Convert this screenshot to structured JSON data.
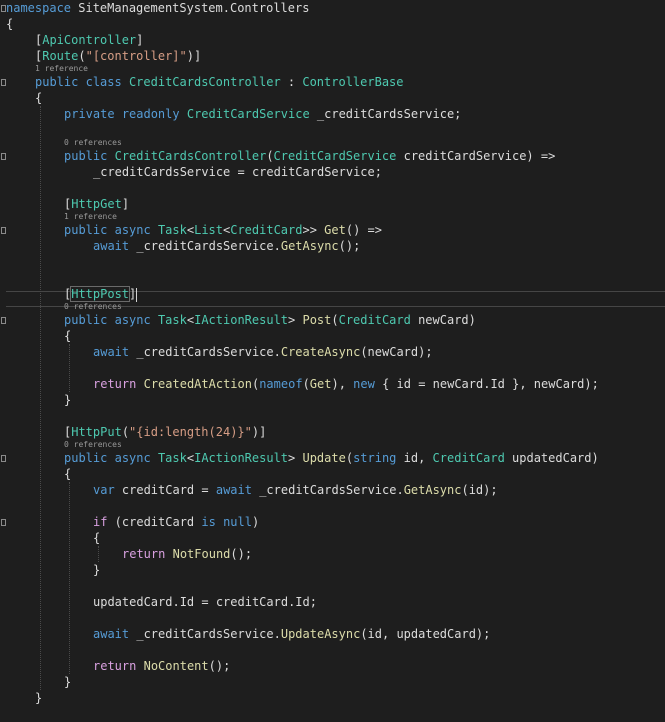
{
  "editor": {
    "colors": {
      "background": "#1e1e1e",
      "keyword": "#569cd6",
      "type": "#4ec9b0",
      "method": "#dcdcaa",
      "string": "#d69d85",
      "control": "#d8a0df",
      "plain": "#dcdcdc",
      "codelens": "#999999"
    },
    "lines": [
      {
        "kind": "code",
        "indent": 0,
        "fold": "open",
        "tokens": [
          [
            "namespace",
            "kw"
          ],
          [
            " SiteManagementSystem.Controllers",
            "p"
          ]
        ]
      },
      {
        "kind": "code",
        "indent": 0,
        "tokens": [
          [
            "{",
            "p"
          ]
        ]
      },
      {
        "kind": "code",
        "indent": 1,
        "tokens": [
          [
            "[",
            "p"
          ],
          [
            "ApiController",
            "ty"
          ],
          [
            "]",
            "p"
          ]
        ]
      },
      {
        "kind": "code",
        "indent": 1,
        "tokens": [
          [
            "[",
            "p"
          ],
          [
            "Route",
            "ty"
          ],
          [
            "(",
            "p"
          ],
          [
            "\"[controller]\"",
            "str"
          ],
          [
            ")]",
            "p"
          ]
        ]
      },
      {
        "kind": "lens",
        "indent": 1,
        "text": "1 reference"
      },
      {
        "kind": "code",
        "indent": 1,
        "fold": "open",
        "tokens": [
          [
            "public",
            "kw"
          ],
          [
            " ",
            "p"
          ],
          [
            "class",
            "kw"
          ],
          [
            " ",
            "p"
          ],
          [
            "CreditCardsController",
            "ty"
          ],
          [
            " : ",
            "p"
          ],
          [
            "ControllerBase",
            "ty"
          ]
        ]
      },
      {
        "kind": "code",
        "indent": 1,
        "tokens": [
          [
            "{",
            "p"
          ]
        ]
      },
      {
        "kind": "code",
        "indent": 2,
        "tokens": [
          [
            "private",
            "kw"
          ],
          [
            " ",
            "p"
          ],
          [
            "readonly",
            "kw"
          ],
          [
            " ",
            "p"
          ],
          [
            "CreditCardService",
            "ty"
          ],
          [
            " _creditCardsService;",
            "p"
          ]
        ]
      },
      {
        "kind": "blank"
      },
      {
        "kind": "lens",
        "indent": 2,
        "text": "0 references"
      },
      {
        "kind": "code",
        "indent": 2,
        "fold": "open",
        "tokens": [
          [
            "public",
            "kw"
          ],
          [
            " ",
            "p"
          ],
          [
            "CreditCardsController",
            "ty"
          ],
          [
            "(",
            "p"
          ],
          [
            "CreditCardService",
            "ty"
          ],
          [
            " creditCardService",
            "p"
          ],
          [
            ") =>",
            "p"
          ]
        ]
      },
      {
        "kind": "code",
        "indent": 3,
        "tokens": [
          [
            "_creditCardsService = creditCardService;",
            "p"
          ]
        ]
      },
      {
        "kind": "blank"
      },
      {
        "kind": "code",
        "indent": 2,
        "tokens": [
          [
            "[",
            "p"
          ],
          [
            "HttpGet",
            "ty"
          ],
          [
            "]",
            "p"
          ]
        ]
      },
      {
        "kind": "lens",
        "indent": 2,
        "text": "1 reference"
      },
      {
        "kind": "code",
        "indent": 2,
        "fold": "open",
        "tokens": [
          [
            "public",
            "kw"
          ],
          [
            " ",
            "p"
          ],
          [
            "async",
            "kw"
          ],
          [
            " ",
            "p"
          ],
          [
            "Task",
            "ty"
          ],
          [
            "<",
            "p"
          ],
          [
            "List",
            "ty"
          ],
          [
            "<",
            "p"
          ],
          [
            "CreditCard",
            "ty"
          ],
          [
            ">> ",
            "p"
          ],
          [
            "Get",
            "m"
          ],
          [
            "() =>",
            "p"
          ]
        ]
      },
      {
        "kind": "code",
        "indent": 3,
        "tokens": [
          [
            "await",
            "kw"
          ],
          [
            " _creditCardsService.",
            "p"
          ],
          [
            "GetAsync",
            "m"
          ],
          [
            "();",
            "p"
          ]
        ]
      },
      {
        "kind": "blank"
      },
      {
        "kind": "blank"
      },
      {
        "kind": "code",
        "indent": 2,
        "current": true,
        "tokens": [
          [
            "[",
            "p"
          ],
          [
            "HttpPost",
            "ty"
          ],
          [
            "]",
            "p"
          ]
        ]
      },
      {
        "kind": "lens",
        "indent": 2,
        "text": "0 references"
      },
      {
        "kind": "code",
        "indent": 2,
        "fold": "open",
        "tokens": [
          [
            "public",
            "kw"
          ],
          [
            " ",
            "p"
          ],
          [
            "async",
            "kw"
          ],
          [
            " ",
            "p"
          ],
          [
            "Task",
            "ty"
          ],
          [
            "<",
            "p"
          ],
          [
            "IActionResult",
            "ty"
          ],
          [
            "> ",
            "p"
          ],
          [
            "Post",
            "m"
          ],
          [
            "(",
            "p"
          ],
          [
            "CreditCard",
            "ty"
          ],
          [
            " newCard)",
            "p"
          ]
        ]
      },
      {
        "kind": "code",
        "indent": 2,
        "tokens": [
          [
            "{",
            "p"
          ]
        ]
      },
      {
        "kind": "code",
        "indent": 3,
        "tokens": [
          [
            "await",
            "kw"
          ],
          [
            " _creditCardsService.",
            "p"
          ],
          [
            "CreateAsync",
            "m"
          ],
          [
            "(newCard);",
            "p"
          ]
        ]
      },
      {
        "kind": "blank"
      },
      {
        "kind": "code",
        "indent": 3,
        "tokens": [
          [
            "return",
            "ctl"
          ],
          [
            " ",
            "p"
          ],
          [
            "CreatedAtAction",
            "m"
          ],
          [
            "(",
            "p"
          ],
          [
            "nameof",
            "kw"
          ],
          [
            "(",
            "p"
          ],
          [
            "Get",
            "m"
          ],
          [
            "), ",
            "p"
          ],
          [
            "new",
            "kw"
          ],
          [
            " { id = newCard.Id }, newCard);",
            "p"
          ]
        ]
      },
      {
        "kind": "code",
        "indent": 2,
        "tokens": [
          [
            "}",
            "p"
          ]
        ]
      },
      {
        "kind": "blank"
      },
      {
        "kind": "code",
        "indent": 2,
        "tokens": [
          [
            "[",
            "p"
          ],
          [
            "HttpPut",
            "ty"
          ],
          [
            "(",
            "p"
          ],
          [
            "\"{id:length(24)}\"",
            "str"
          ],
          [
            ")]",
            "p"
          ]
        ]
      },
      {
        "kind": "lens",
        "indent": 2,
        "text": "0 references"
      },
      {
        "kind": "code",
        "indent": 2,
        "fold": "open",
        "tokens": [
          [
            "public",
            "kw"
          ],
          [
            " ",
            "p"
          ],
          [
            "async",
            "kw"
          ],
          [
            " ",
            "p"
          ],
          [
            "Task",
            "ty"
          ],
          [
            "<",
            "p"
          ],
          [
            "IActionResult",
            "ty"
          ],
          [
            "> ",
            "p"
          ],
          [
            "Update",
            "m"
          ],
          [
            "(",
            "p"
          ],
          [
            "string",
            "kw"
          ],
          [
            " id, ",
            "p"
          ],
          [
            "CreditCard",
            "ty"
          ],
          [
            " updatedCard)",
            "p"
          ]
        ]
      },
      {
        "kind": "code",
        "indent": 2,
        "tokens": [
          [
            "{",
            "p"
          ]
        ]
      },
      {
        "kind": "code",
        "indent": 3,
        "tokens": [
          [
            "var",
            "kw"
          ],
          [
            " creditCard = ",
            "p"
          ],
          [
            "await",
            "kw"
          ],
          [
            " _creditCardsService.",
            "p"
          ],
          [
            "GetAsync",
            "m"
          ],
          [
            "(id);",
            "p"
          ]
        ]
      },
      {
        "kind": "blank"
      },
      {
        "kind": "code",
        "indent": 3,
        "fold": "open",
        "tokens": [
          [
            "if",
            "ctl"
          ],
          [
            " (creditCard ",
            "p"
          ],
          [
            "is",
            "kw"
          ],
          [
            " ",
            "p"
          ],
          [
            "null",
            "kw"
          ],
          [
            ")",
            "p"
          ]
        ]
      },
      {
        "kind": "code",
        "indent": 3,
        "tokens": [
          [
            "{",
            "p"
          ]
        ]
      },
      {
        "kind": "code",
        "indent": 4,
        "tokens": [
          [
            "return",
            "ctl"
          ],
          [
            " ",
            "p"
          ],
          [
            "NotFound",
            "m"
          ],
          [
            "();",
            "p"
          ]
        ]
      },
      {
        "kind": "code",
        "indent": 3,
        "tokens": [
          [
            "}",
            "p"
          ]
        ]
      },
      {
        "kind": "blank"
      },
      {
        "kind": "code",
        "indent": 3,
        "tokens": [
          [
            "updatedCard.Id = creditCard.Id;",
            "p"
          ]
        ]
      },
      {
        "kind": "blank"
      },
      {
        "kind": "code",
        "indent": 3,
        "tokens": [
          [
            "await",
            "kw"
          ],
          [
            " _creditCardsService.",
            "p"
          ],
          [
            "UpdateAsync",
            "m"
          ],
          [
            "(id, updatedCard);",
            "p"
          ]
        ]
      },
      {
        "kind": "blank"
      },
      {
        "kind": "code",
        "indent": 3,
        "tokens": [
          [
            "return",
            "ctl"
          ],
          [
            " ",
            "p"
          ],
          [
            "NoContent",
            "m"
          ],
          [
            "();",
            "p"
          ]
        ]
      },
      {
        "kind": "code",
        "indent": 2,
        "tokens": [
          [
            "}",
            "p"
          ]
        ]
      },
      {
        "kind": "code",
        "indent": 1,
        "tokens": [
          [
            "}",
            "p"
          ]
        ]
      }
    ]
  }
}
